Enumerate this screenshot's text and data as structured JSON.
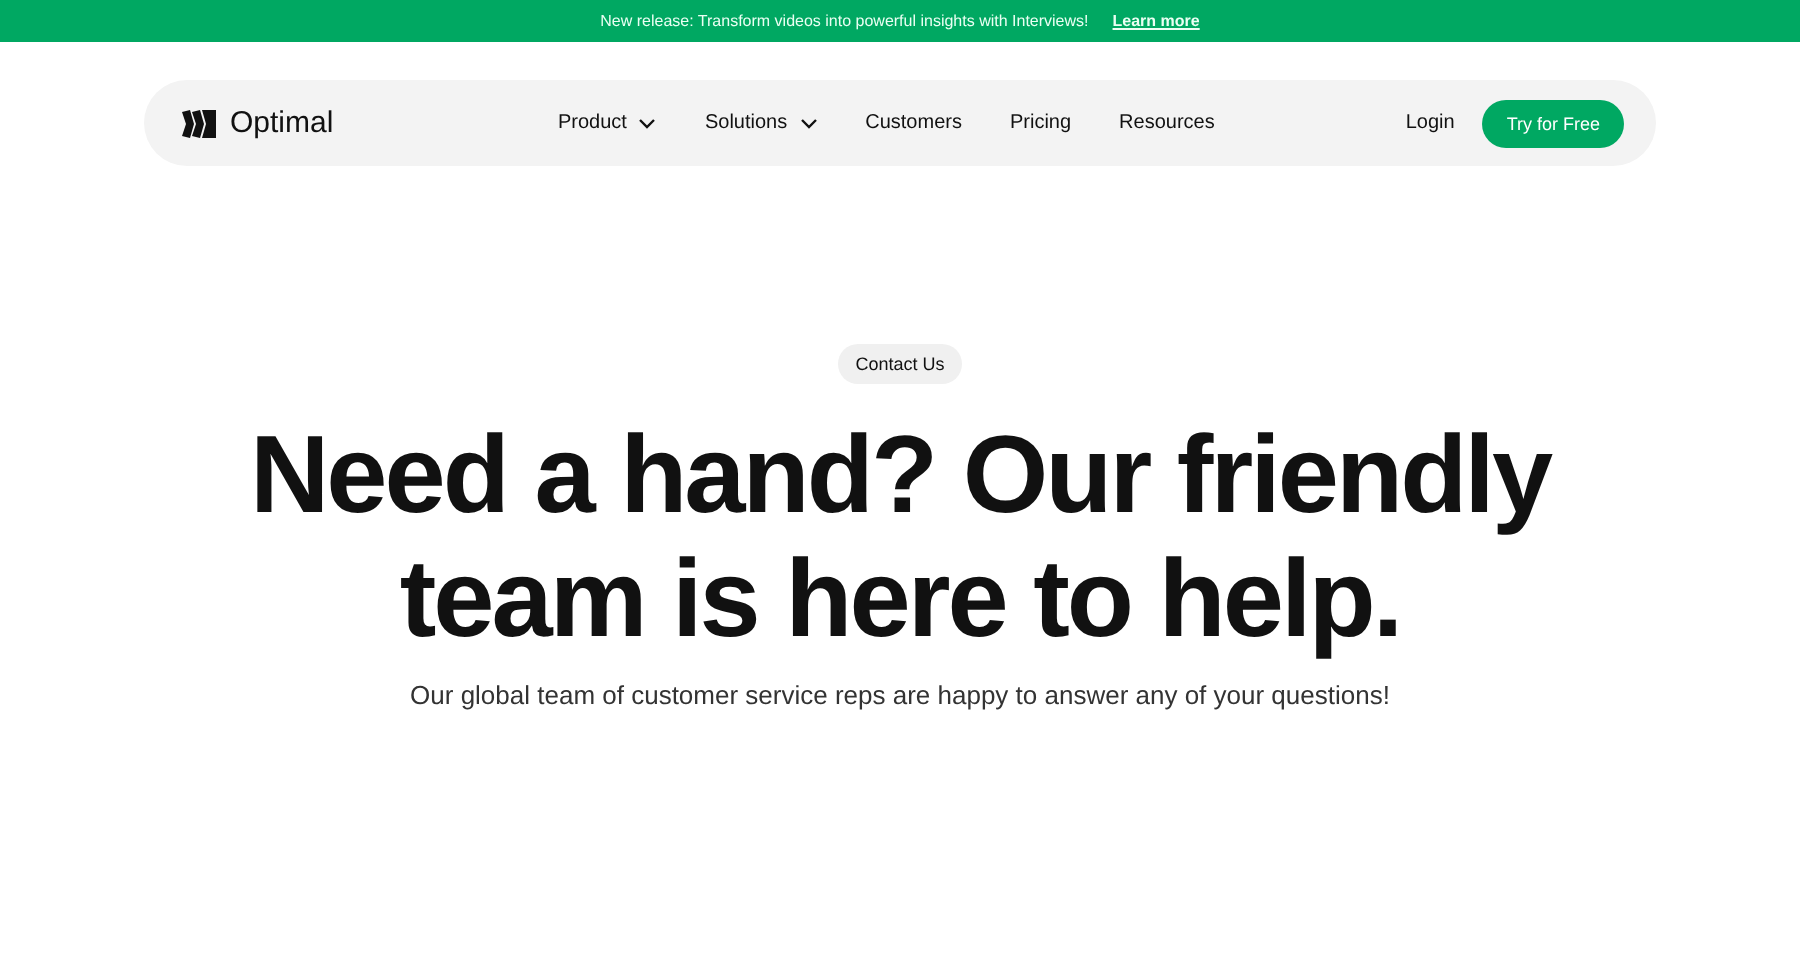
{
  "announcement": {
    "text": "New release: Transform videos into powerful insights with Interviews!",
    "link": "Learn more"
  },
  "nav": {
    "brand": "Optimal",
    "items": [
      {
        "label": "Product",
        "has_menu": true
      },
      {
        "label": "Solutions",
        "has_menu": true
      },
      {
        "label": "Customers",
        "has_menu": false
      },
      {
        "label": "Pricing",
        "has_menu": false
      },
      {
        "label": "Resources",
        "has_menu": false
      }
    ],
    "login": "Login",
    "cta": "Try for Free"
  },
  "hero": {
    "badge": "Contact Us",
    "heading": "Need a hand? Our friendly team is here to help.",
    "subtitle": "Our global team of customer service reps are happy to answer any of your questions!"
  }
}
